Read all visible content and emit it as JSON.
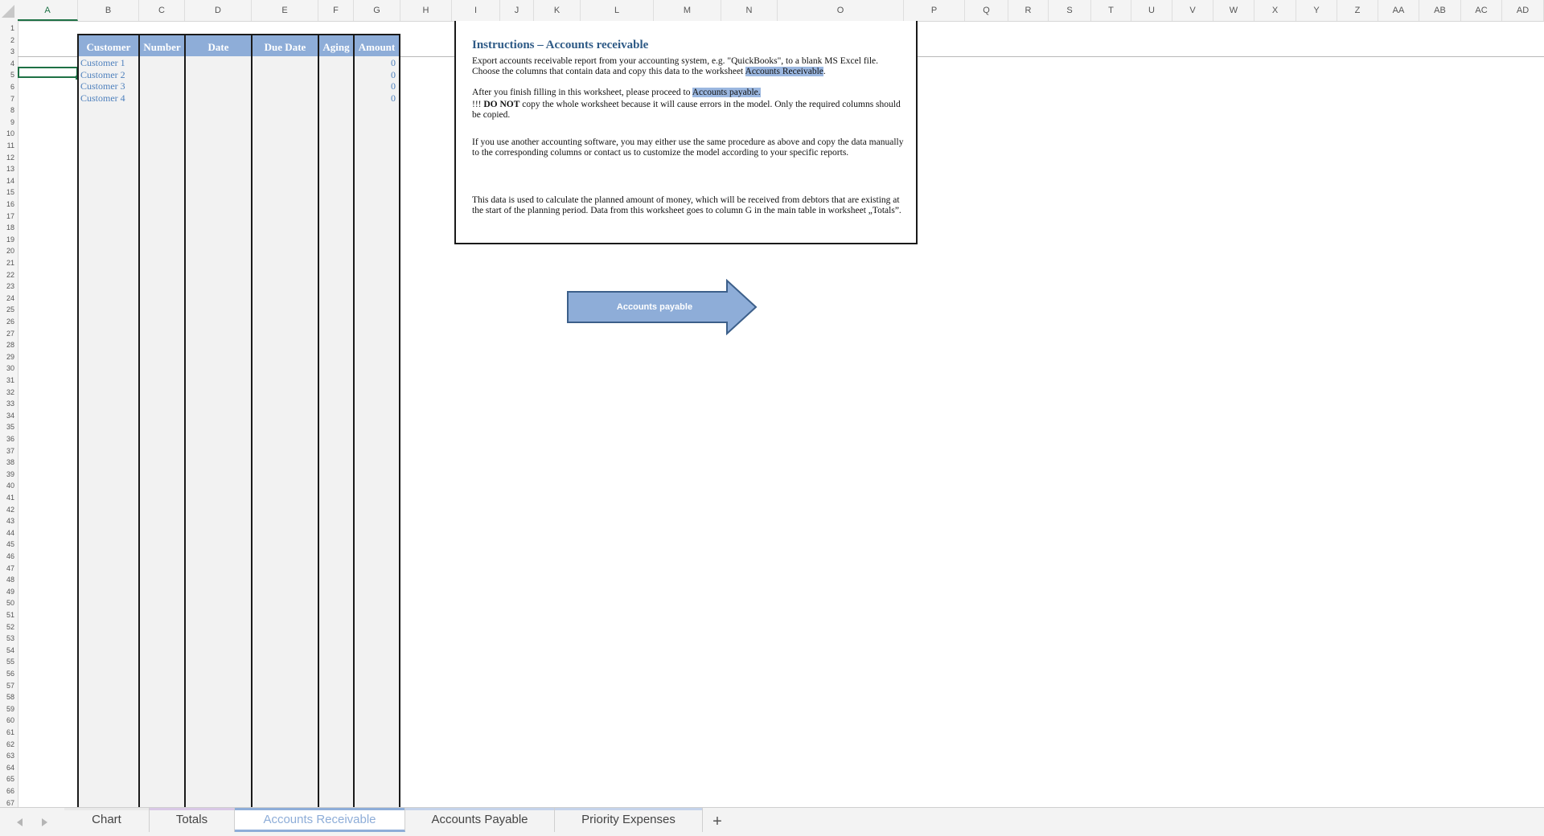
{
  "columns": [
    "A",
    "B",
    "C",
    "D",
    "E",
    "F",
    "G",
    "H",
    "I",
    "J",
    "K",
    "L",
    "M",
    "N",
    "O",
    "P",
    "Q",
    "R",
    "S",
    "T",
    "U",
    "V",
    "W",
    "X",
    "Y",
    "Z",
    "AA",
    "AB",
    "AC",
    "AD"
  ],
  "selected_column": "A",
  "selected_row": "5",
  "rows": [
    "1",
    "2",
    "3",
    "4",
    "5",
    "6",
    "7",
    "8",
    "9",
    "10",
    "11",
    "12",
    "13",
    "14",
    "15",
    "16",
    "17",
    "18",
    "19",
    "20",
    "21",
    "22",
    "23",
    "24",
    "25",
    "26",
    "27",
    "28",
    "29",
    "30",
    "31",
    "32",
    "33",
    "34",
    "35",
    "36",
    "37",
    "38",
    "39",
    "40",
    "41",
    "42",
    "43",
    "44",
    "45",
    "46",
    "47",
    "48",
    "49",
    "50",
    "51",
    "52",
    "53",
    "54",
    "55",
    "56",
    "57",
    "58",
    "59",
    "60",
    "61",
    "62",
    "63",
    "64",
    "65",
    "66",
    "67"
  ],
  "table": {
    "headers": [
      "Customer",
      "Number",
      "Date",
      "Due Date",
      "Aging",
      "Amount"
    ],
    "rows": [
      {
        "customer": "Customer 1",
        "amount": "0"
      },
      {
        "customer": "Customer 2",
        "amount": "0"
      },
      {
        "customer": "Customer 3",
        "amount": "0"
      },
      {
        "customer": "Customer 4",
        "amount": "0"
      }
    ]
  },
  "instructions": {
    "title": "Instructions – Accounts receivable",
    "p1_a": "Export accounts receivable report from your accounting system, e.g. \"QuickBooks\", to a blank MS Excel file. Choose the columns that contain data and copy this data to the worksheet",
    "p1_hl": "Accounts Receivable",
    "p1_end": ".",
    "p2_a": "After you finish filling in this worksheet, please proceed to",
    "p2_hl": "Accounts payable.",
    "p3_a": "!!! ",
    "p3_bold": "DO NOT",
    "p3_b": " copy the whole worksheet because it will cause errors in the model. Only the required columns should be copied.",
    "p4": "If you use another accounting software, you may either use the same procedure as above and copy the data manually to the corresponding columns or contact us to customize the model according to your specific reports.",
    "p5": "This data is used to calculate the planned amount of money, which will be received from debtors that are existing at the start of the planning period. Data from this worksheet goes to column G in the main table in worksheet „Totals”."
  },
  "arrow_button": {
    "label": "Accounts payable",
    "fill": "#8eadd8",
    "stroke": "#3c5f8a"
  },
  "sheet_tabs": [
    {
      "label": "Chart",
      "color": "#e9e9e9"
    },
    {
      "label": "Totals",
      "color": "#d9c8e6"
    },
    {
      "label": "Accounts Receivable",
      "color": "#8eadd8"
    },
    {
      "label": "Accounts Payable",
      "color": "#c5d3ea"
    },
    {
      "label": "Priority Expenses",
      "color": "#c5d3ea"
    }
  ],
  "active_tab": "Accounts Receivable",
  "add_sheet_label": "+"
}
